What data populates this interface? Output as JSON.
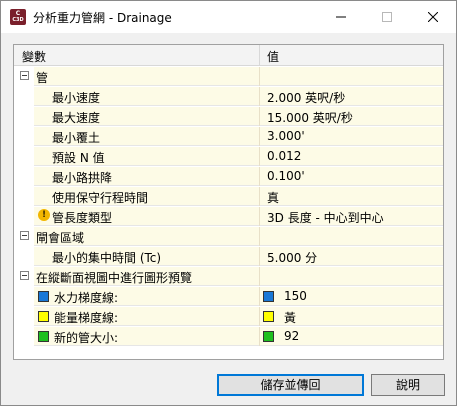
{
  "window": {
    "title": "分析重力管網 - Drainage",
    "app_icon": {
      "top": "C",
      "bottom": "C3D"
    },
    "icons": {
      "minimize": "minimize-icon",
      "maximize": "maximize-icon",
      "close": "close-icon"
    }
  },
  "grid": {
    "header": {
      "name": "變數",
      "value": "值"
    },
    "groups": [
      {
        "label": "管",
        "rows": [
          {
            "name": "最小速度",
            "value": "2.000 英呎/秒"
          },
          {
            "name": "最大速度",
            "value": "15.000 英呎/秒"
          },
          {
            "name": "最小覆土",
            "value": "3.000'"
          },
          {
            "name": "預設 N 值",
            "value": "0.012"
          },
          {
            "name": "最小路拱降",
            "value": "0.100'"
          },
          {
            "name": "使用保守行程時間",
            "value": "真"
          },
          {
            "name": "管長度類型",
            "value": "3D 長度 - 中心到中心",
            "warning": true
          }
        ]
      },
      {
        "label": "閘會區域",
        "rows": [
          {
            "name": "最小的集中時間 (Tc)",
            "value": "5.000 分"
          }
        ]
      },
      {
        "label": "在縱斷面視圖中進行圖形預覽",
        "rows": [
          {
            "name": "水力梯度線:",
            "value": "150",
            "color": "#1a78d6"
          },
          {
            "name": "能量梯度線:",
            "value": "黃",
            "color": "#ffff00"
          },
          {
            "name": "新的管大小:",
            "value": "92",
            "color": "#1fbf1f"
          }
        ]
      }
    ]
  },
  "buttons": {
    "save": "儲存並傳回",
    "help": "說明"
  }
}
